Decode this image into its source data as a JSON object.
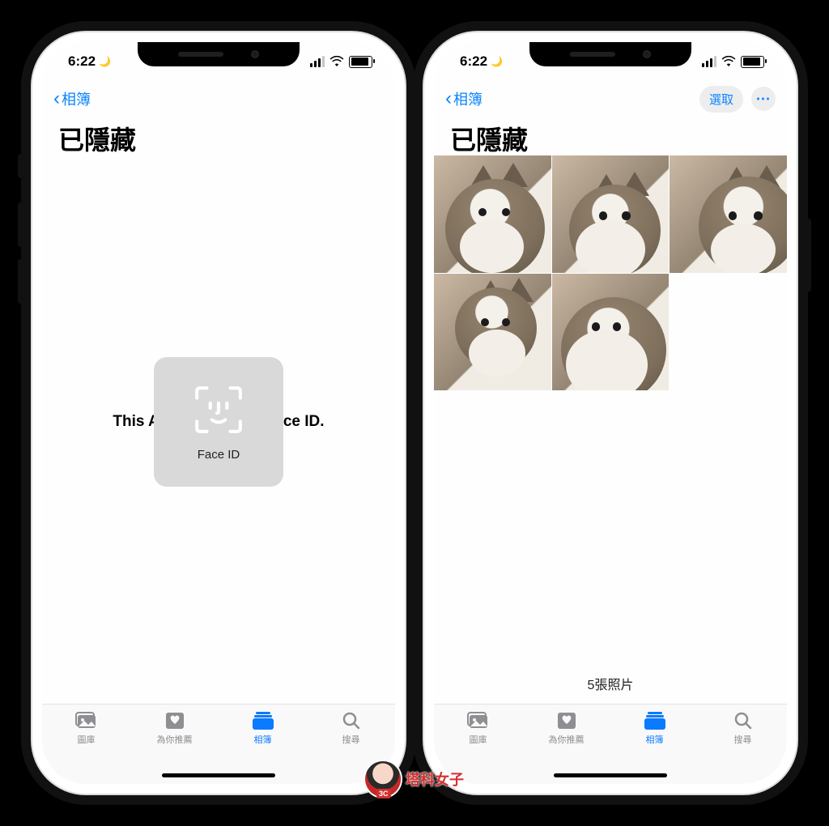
{
  "statusbar": {
    "time": "6:22"
  },
  "nav": {
    "back_label": "相簿",
    "select_label": "選取"
  },
  "title": "已隱藏",
  "left_phone": {
    "locked_message": "This Album requires Face ID.",
    "faceid_label": "Face ID"
  },
  "right_phone": {
    "count_label": "5張照片",
    "photos": [
      {
        "desc": "cat-photo-1"
      },
      {
        "desc": "cat-photo-2"
      },
      {
        "desc": "cat-photo-3"
      },
      {
        "desc": "cat-photo-4"
      },
      {
        "desc": "cat-photo-5"
      }
    ]
  },
  "tabs": {
    "library": "圖庫",
    "for_you": "為你推薦",
    "albums": "相簿",
    "search": "搜尋"
  },
  "watermark": {
    "text": "塔科女子",
    "badge": "3C"
  },
  "colors": {
    "accent": "#0a84ff",
    "inactive": "#8e8e93"
  }
}
